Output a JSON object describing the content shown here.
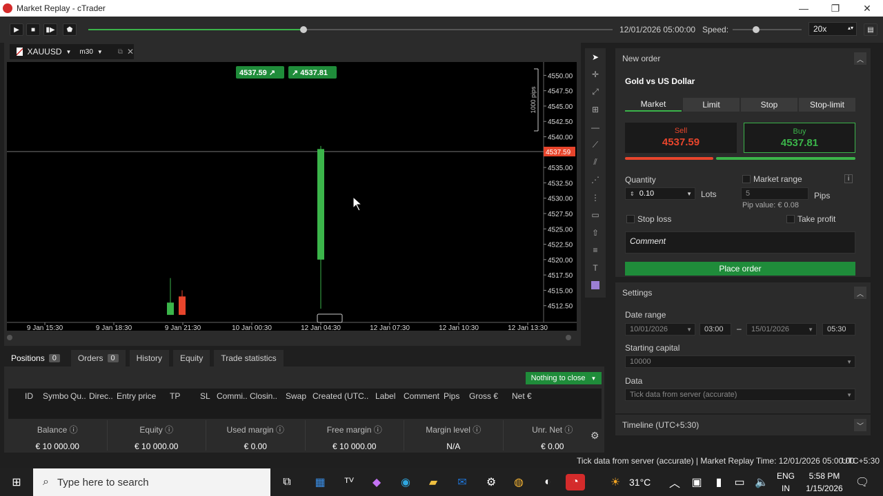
{
  "window": {
    "title": "Market Replay - cTrader"
  },
  "replay": {
    "datetime": "12/01/2026 05:00:00",
    "speed_label": "Speed:",
    "speed_value": "20x",
    "progress": 0.41
  },
  "chart": {
    "symbol": "XAUUSD",
    "timeframe": "m30",
    "sell_chip": "4537.59",
    "buy_chip": "4537.81",
    "pips_label": "1000 pips",
    "current_price_label": "4537.59",
    "y_ticks": [
      "4550.00",
      "4547.50",
      "4545.00",
      "4542.50",
      "4540.00",
      "4537.50",
      "4535.00",
      "4532.50",
      "4530.00",
      "4527.50",
      "4525.00",
      "4522.50",
      "4520.00",
      "4517.50",
      "4515.00",
      "4512.50"
    ],
    "x_ticks": [
      "9 Jan 15:30",
      "9 Jan 18:30",
      "9 Jan 21:30",
      "10 Jan 00:30",
      "12 Jan 04:30",
      "12 Jan 07:30",
      "12 Jan 10:30",
      "12 Jan 13:30"
    ]
  },
  "chart_data": {
    "type": "candlestick",
    "ylim": [
      4510.0,
      4551.5
    ],
    "current_price": 4537.59,
    "candles": [
      {
        "x": "9 Jan 21:30",
        "open": 4511.0,
        "close": 4513.0,
        "high": 4517.0,
        "low": 4511.0,
        "direction": "up"
      },
      {
        "x": "9 Jan 21:30",
        "open": 4514.0,
        "close": 4511.0,
        "high": 4515.0,
        "low": 4511.0,
        "direction": "down"
      },
      {
        "x": "12 Jan 04:30",
        "open": 4520.0,
        "close": 4538.0,
        "high": 4538.5,
        "low": 4512.0,
        "direction": "up"
      }
    ]
  },
  "bottom": {
    "tabs": [
      {
        "label": "Positions",
        "badge": "0"
      },
      {
        "label": "Orders",
        "badge": "0"
      },
      {
        "label": "History"
      },
      {
        "label": "Equity"
      },
      {
        "label": "Trade statistics"
      }
    ],
    "nothing_to_close": "Nothing to close",
    "columns": [
      "ID",
      "Symbo",
      "Qu..",
      "Direc..",
      "Entry price",
      "TP",
      "SL",
      "Commi..",
      "Closin..",
      "Swap",
      "Created (UTC..",
      "Label",
      "Comment",
      "Pips",
      "Gross €",
      "Net €"
    ],
    "balances": [
      {
        "label": "Balance",
        "value": "€ 10 000.00"
      },
      {
        "label": "Equity",
        "value": "€ 10 000.00"
      },
      {
        "label": "Used margin",
        "value": "€ 0.00"
      },
      {
        "label": "Free margin",
        "value": "€ 10 000.00"
      },
      {
        "label": "Margin level",
        "value": "N/A"
      },
      {
        "label": "Unr. Net",
        "value": "€ 0.00"
      }
    ]
  },
  "order": {
    "header": "New order",
    "instrument": "Gold vs US Dollar",
    "tabs": [
      "Market",
      "Limit",
      "Stop",
      "Stop-limit"
    ],
    "sell_label": "Sell",
    "sell_price": "4537.59",
    "buy_label": "Buy",
    "buy_price": "4537.81",
    "quantity_label": "Quantity",
    "quantity_value": "0.10",
    "lots_label": "Lots",
    "market_range_label": "Market range",
    "range_value": "5",
    "pips_label": "Pips",
    "pip_value": "Pip value: € 0.08",
    "stop_loss": "Stop loss",
    "take_profit": "Take profit",
    "comment_placeholder": "Comment",
    "place_order": "Place order"
  },
  "settings": {
    "header": "Settings",
    "date_range_label": "Date range",
    "start_date": "10/01/2026",
    "start_time": "03:00",
    "end_date": "15/01/2026",
    "end_time": "05:30",
    "capital_label": "Starting capital",
    "capital_value": "10000",
    "data_label": "Data",
    "data_value": "Tick data from server (accurate)"
  },
  "timeline": {
    "header": "Timeline (UTC+5:30)"
  },
  "status": {
    "text": "Tick data from server (accurate)  |  Market Replay Time: 12/01/2026 05:00:00",
    "tz": "UTC+5:30"
  },
  "taskbar": {
    "search_placeholder": "Type here to search",
    "temp": "31°C",
    "lang1": "ENG",
    "lang2": "IN",
    "time": "5:58 PM",
    "date": "1/15/2026"
  },
  "colors": {
    "green": "#3bb54a",
    "red": "#e8452c",
    "accent_green_btn": "#1f8c3a"
  }
}
